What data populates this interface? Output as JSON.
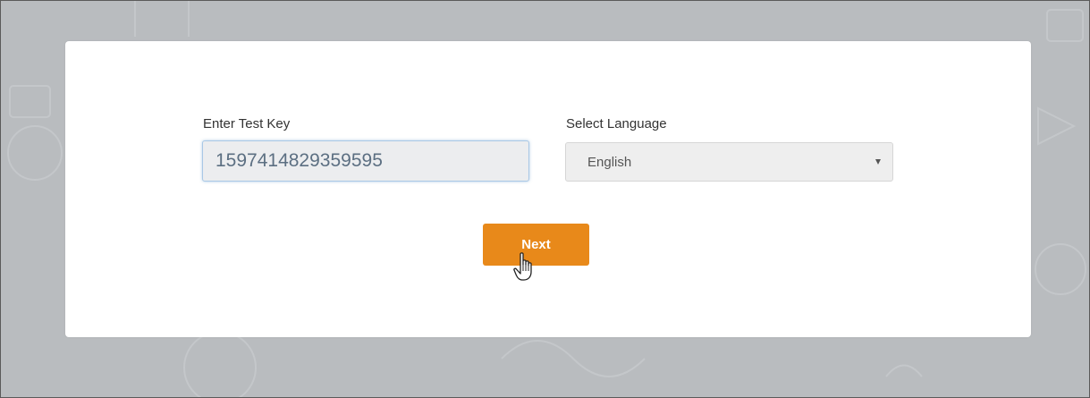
{
  "form": {
    "test_key_label": "Enter Test Key",
    "test_key_value": "1597414829359595",
    "language_label": "Select Language",
    "language_selected": "English",
    "next_label": "Next"
  },
  "colors": {
    "background": "#b9bcbf",
    "card": "#ffffff",
    "accent": "#e8891a",
    "input_bg": "#ecedef",
    "input_border": "#a9c8e6",
    "input_text": "#5c6f82"
  },
  "icons": {
    "dropdown": "caret-down-icon",
    "cursor": "hand-pointer-icon"
  }
}
